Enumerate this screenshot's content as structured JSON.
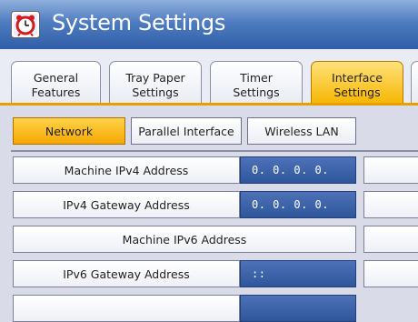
{
  "window": {
    "title": "System Settings"
  },
  "tabs": [
    {
      "label": "General\nFeatures"
    },
    {
      "label": "Tray Paper\nSettings"
    },
    {
      "label": "Timer\nSettings"
    },
    {
      "label": "Interface\nSettings",
      "active": true
    }
  ],
  "subtabs": [
    {
      "label": "Network",
      "active": true
    },
    {
      "label": "Parallel Interface"
    },
    {
      "label": "Wireless LAN"
    }
  ],
  "rows": [
    {
      "label": "Machine IPv4 Address",
      "value": "0.  0.  0.  0."
    },
    {
      "label": "IPv4 Gateway Address",
      "value": "0.  0.  0.  0."
    },
    {
      "label": "Machine IPv6 Address"
    },
    {
      "label": "IPv6 Gateway Address",
      "value": "::"
    }
  ],
  "colors": {
    "accent": "#f5a800",
    "title_bar": "#2f5ea8",
    "value_field": "#3a62aa"
  }
}
